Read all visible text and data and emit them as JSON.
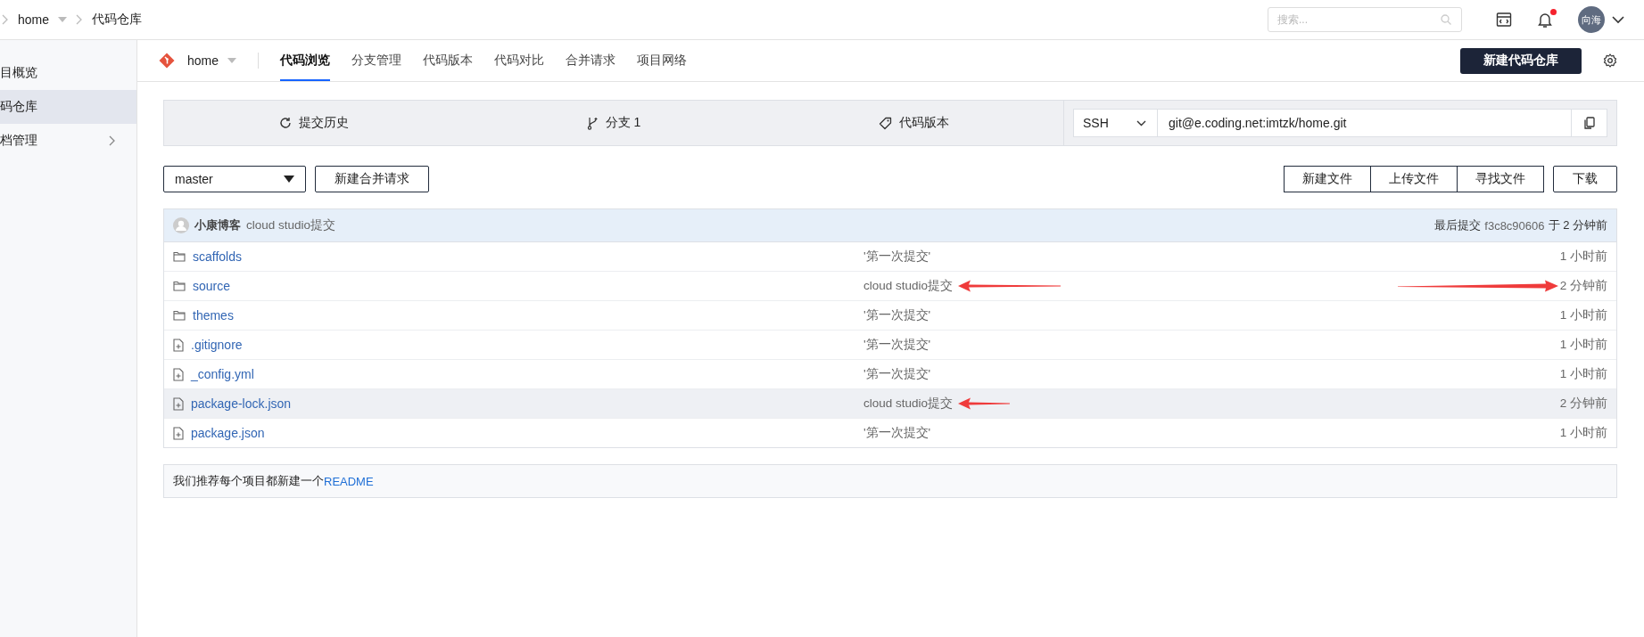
{
  "breadcrumb": [
    {
      "label": "home",
      "has_caret": true
    },
    {
      "label": "代码仓库",
      "has_caret": false
    }
  ],
  "search": {
    "placeholder": "搜索..."
  },
  "notifications": {
    "unread": true
  },
  "avatar": {
    "label": "向海"
  },
  "sidebar": {
    "items": [
      {
        "label": "目概览",
        "selected": false,
        "has_submenu": false
      },
      {
        "label": "码仓库",
        "selected": true,
        "has_submenu": false
      },
      {
        "label": "档管理",
        "selected": false,
        "has_submenu": true
      }
    ]
  },
  "repo": {
    "name": "home"
  },
  "tabs": [
    {
      "label": "代码浏览",
      "selected": true
    },
    {
      "label": "分支管理",
      "selected": false
    },
    {
      "label": "代码版本",
      "selected": false
    },
    {
      "label": "代码对比",
      "selected": false
    },
    {
      "label": "合并请求",
      "selected": false
    },
    {
      "label": "项目网络",
      "selected": false
    }
  ],
  "primary_button": "新建代码仓库",
  "stats": [
    {
      "kind": "history",
      "label": "提交历史"
    },
    {
      "kind": "branch",
      "label": "分支 1"
    },
    {
      "kind": "tag",
      "label": "代码版本"
    }
  ],
  "clone": {
    "protocol": "SSH",
    "url": "git@e.coding.net:imtzk/home.git"
  },
  "branch_select": {
    "value": "master"
  },
  "merge_button": "新建合并请求",
  "file_buttons": [
    "新建文件",
    "上传文件",
    "寻找文件"
  ],
  "download_button": "下载",
  "last_commit": {
    "author": "小康博客",
    "message": "cloud studio提交",
    "label": "最后提交",
    "hash": "f3c8c90606",
    "time": "于 2 分钟前"
  },
  "files": [
    {
      "kind": "folder",
      "name": "scaffolds",
      "message": "'第一次提交'",
      "time": "1 小时前",
      "hovered": false,
      "message_marked": false,
      "time_marked": false
    },
    {
      "kind": "folder",
      "name": "source",
      "message": "cloud studio提交",
      "time": "2 分钟前",
      "hovered": false,
      "message_marked": true,
      "time_marked": true
    },
    {
      "kind": "folder",
      "name": "themes",
      "message": "'第一次提交'",
      "time": "1 小时前",
      "hovered": false,
      "message_marked": false,
      "time_marked": false
    },
    {
      "kind": "file",
      "name": ".gitignore",
      "message": "'第一次提交'",
      "time": "1 小时前",
      "hovered": false,
      "message_marked": false,
      "time_marked": false
    },
    {
      "kind": "file",
      "name": "_config.yml",
      "message": "'第一次提交'",
      "time": "1 小时前",
      "hovered": false,
      "message_marked": false,
      "time_marked": false
    },
    {
      "kind": "file",
      "name": "package-lock.json",
      "message": "cloud studio提交",
      "time": "2 分钟前",
      "hovered": true,
      "message_marked": true,
      "time_marked": false
    },
    {
      "kind": "file",
      "name": "package.json",
      "message": "'第一次提交'",
      "time": "1 小时前",
      "hovered": false,
      "message_marked": false,
      "time_marked": false
    }
  ],
  "readme_notice": {
    "text": "我们推荐每个项目都新建一个",
    "link": "README"
  }
}
